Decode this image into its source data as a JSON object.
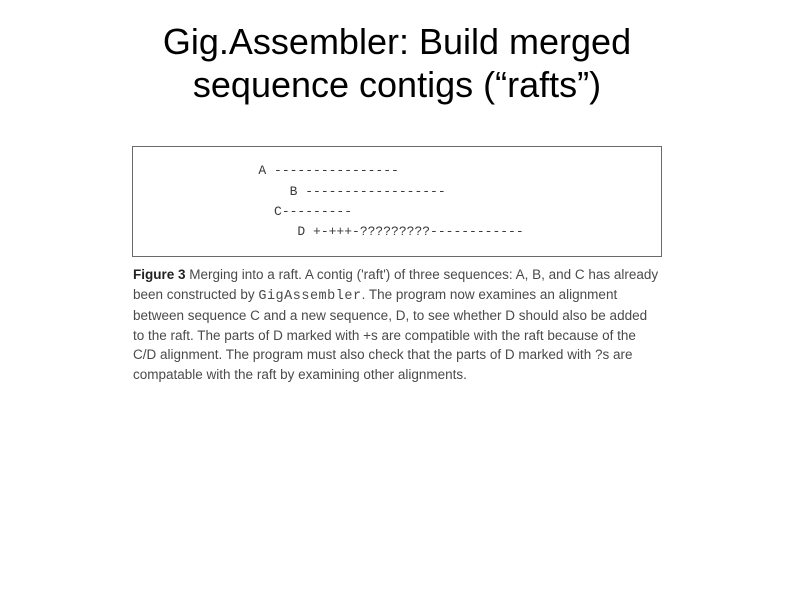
{
  "slide": {
    "title": "Gig.Assembler: Build merged sequence contigs (“rafts”)"
  },
  "figure": {
    "diagram": "             A ----------------               \n                 B ------------------          \n               C---------                      \n                  D +-+++-?????????------------"
  },
  "caption": {
    "label": "Figure 3",
    "text_before_prog": "   Merging into a raft. A contig ('raft') of three sequences: A, B, and C has already been constructed by ",
    "prog_name": "GigAssembler",
    "text_after_prog": ". The program now examines an alignment between sequence C and a new sequence, D, to see whether D should also be added to the raft. The parts of D marked with +s are compatible with the raft because of the C/D alignment. The program must also check that the parts of D marked with ?s are compatable with the raft by examining other alignments."
  }
}
